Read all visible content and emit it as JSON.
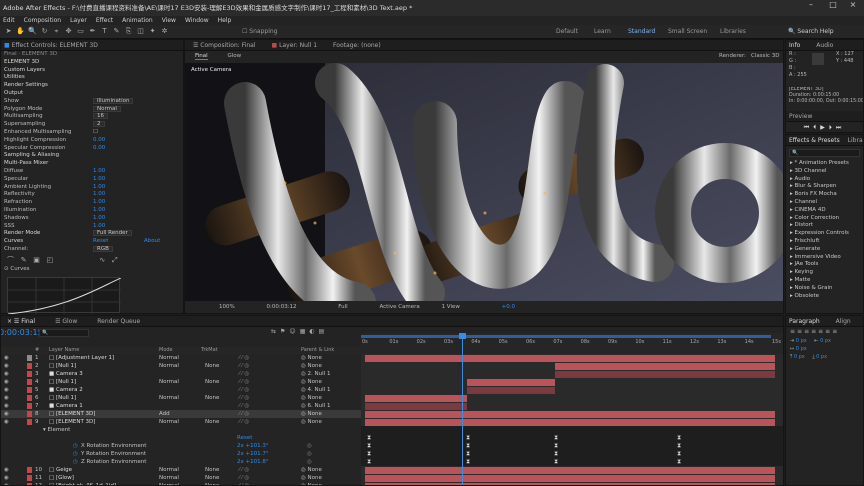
{
  "app": {
    "title": "Adobe After Effects - F:\\付费直播课程资料准备\\AE\\课时17 E3D安装-理解E3D效果和金属质感文字制作\\课时17_工程和素材\\3D Text.aep *"
  },
  "menu": [
    "Edit",
    "Composition",
    "Layer",
    "Effect",
    "Animation",
    "View",
    "Window",
    "Help"
  ],
  "toolbar": {
    "snapping": "Snapping",
    "workspaces": [
      "Default",
      "Learn",
      "Standard",
      "Small Screen",
      "Libraries"
    ],
    "active_workspace": "Standard",
    "search_help": "Search Help"
  },
  "effect_controls": {
    "tab": "Effect Controls: ELEMENT 3D",
    "crumb": "Final · ELEMENT 3D",
    "rows": [
      {
        "t": "ELEMENT 3D",
        "v": ""
      },
      {
        "t": "Custom Layers",
        "v": ""
      },
      {
        "t": "Utilities",
        "v": ""
      },
      {
        "t": "Render Settings",
        "v": ""
      },
      {
        "t": "Output",
        "v": ""
      },
      {
        "t": "  Show",
        "v": "Illumination",
        "dd": true
      },
      {
        "t": "  Polygon Mode",
        "v": "Normal",
        "dd": true
      },
      {
        "t": "  Multisampling",
        "v": "16",
        "dd": true
      },
      {
        "t": "  Supersampling",
        "v": "2",
        "dd": true
      },
      {
        "t": "  Enhanced Multisampling",
        "v": "☐"
      },
      {
        "t": "  Highlight Compression",
        "v": "0.00",
        "num": true
      },
      {
        "t": "  Specular Compression",
        "v": "0.00",
        "num": true
      },
      {
        "t": "Sampling & Aliasing",
        "v": ""
      },
      {
        "t": "Multi-Pass Mixer",
        "v": ""
      },
      {
        "t": "   Diffuse",
        "v": "1.00",
        "num": true
      },
      {
        "t": "   Specular",
        "v": "1.00",
        "num": true
      },
      {
        "t": "   Ambient Lighting",
        "v": "1.00",
        "num": true
      },
      {
        "t": "   Reflectivity",
        "v": "1.00",
        "num": true
      },
      {
        "t": "   Refraction",
        "v": "1.00",
        "num": true
      },
      {
        "t": "   Illumination",
        "v": "1.00",
        "num": true
      },
      {
        "t": "   Shadows",
        "v": "1.00",
        "num": true
      },
      {
        "t": "   SSS",
        "v": "1.00",
        "num": true
      },
      {
        "t": "Render Mode",
        "v": "Full Render",
        "dd": true
      }
    ],
    "curves": {
      "label": "Curves",
      "reset": "Reset",
      "about": "About"
    },
    "channel": {
      "label": "Channel:",
      "value": "RGB"
    },
    "curves_sub": "Curves"
  },
  "composition": {
    "tab_comp": "Composition: Final",
    "tab_layer": "Layer: Null 1",
    "tab_footage": "Footage: (none)",
    "sub_tabs": [
      "Final",
      "Glow"
    ],
    "renderer": "Renderer:",
    "renderer_value": "Classic 3D",
    "camera_label": "Active Camera",
    "footer": {
      "zoom": "100%",
      "time": "0:00:03:12",
      "res": "Full",
      "camera": "Active Camera",
      "view": "1 View",
      "offset": "+0.0"
    }
  },
  "info_panel": {
    "tabs": [
      "Info",
      "Audio"
    ],
    "lines": [
      "R :",
      "G :",
      "B :",
      "A : 255"
    ],
    "coords": [
      "X : 127",
      "Y : 448"
    ],
    "layer_lines": [
      "[ELEMENT 3D]",
      "Duration: 0:00:15:00",
      "In: 0:00:00:00, Out: 0:00:15:00"
    ],
    "preview": "Preview"
  },
  "effects_presets": {
    "tabs": [
      "Effects & Presets",
      "Libra"
    ],
    "search_placeholder": "",
    "items": [
      "Animation Presets",
      "3D Channel",
      "Audio",
      "Blur & Sharpen",
      "Boris FX Mocha",
      "Channel",
      "CINEMA 4D",
      "Color Correction",
      "Distort",
      "Expression Controls",
      "Frischluft",
      "Generate",
      "Immersive Video",
      "JAe Tools",
      "Keying",
      "Matte",
      "Noise & Grain",
      "Obsolete"
    ]
  },
  "paragraph": {
    "tabs": [
      "Paragraph",
      "Align"
    ],
    "fields": [
      "0 px",
      "0 px",
      "0 px",
      "0 px",
      "0 px"
    ]
  },
  "timeline": {
    "tabs": [
      "Final",
      "Glow",
      "Render Queue"
    ],
    "timecode": "0:00:03:15",
    "search_placeholder": "",
    "headers": {
      "num": "#",
      "name": "Layer Name",
      "mode": "Mode",
      "trkmat": "TrkMat",
      "switches": "",
      "parent": "Parent & Link"
    },
    "ruler": [
      "0s",
      "01s",
      "02s",
      "03s",
      "04s",
      "05s",
      "06s",
      "07s",
      "08s",
      "09s",
      "10s",
      "11s",
      "12s",
      "13s",
      "14s",
      "15s"
    ],
    "layers": [
      {
        "n": "1",
        "name": "[Adjustment Layer 1]",
        "mode": "Normal",
        "trk": "",
        "parent": "None",
        "color": "#8c8c8c"
      },
      {
        "n": "2",
        "name": "[Null 1]",
        "mode": "Normal",
        "trk": "None",
        "parent": "None",
        "color": "#c04848"
      },
      {
        "n": "3",
        "name": "Camera 3",
        "mode": "",
        "trk": "",
        "parent": "2. Null 1",
        "color": "#c04848"
      },
      {
        "n": "4",
        "name": "[Null 1]",
        "mode": "Normal",
        "trk": "None",
        "parent": "None",
        "color": "#c04848"
      },
      {
        "n": "5",
        "name": "Camera 2",
        "mode": "",
        "trk": "",
        "parent": "4. Null 1",
        "color": "#c04848"
      },
      {
        "n": "6",
        "name": "[Null 1]",
        "mode": "Normal",
        "trk": "None",
        "parent": "None",
        "color": "#c04848"
      },
      {
        "n": "7",
        "name": "Camera 1",
        "mode": "",
        "trk": "",
        "parent": "6. Null 1",
        "color": "#c04848"
      },
      {
        "n": "8",
        "name": "[ELEMENT 3D]",
        "mode": "Add",
        "trk": "",
        "parent": "None",
        "color": "#c04848"
      },
      {
        "n": "9",
        "name": "[ELEMENT 3D]",
        "mode": "Normal",
        "trk": "None",
        "parent": "None",
        "color": "#c04848"
      }
    ],
    "sub_rows": [
      {
        "label": "Element",
        "value": "",
        "kind": "group"
      },
      {
        "label": "Reset",
        "value": "",
        "kind": "reset"
      },
      {
        "label": "X Rotation Environment",
        "value": "2x +101.3°",
        "kind": "prop"
      },
      {
        "label": "Y Rotation Environment",
        "value": "2x +101.7°",
        "kind": "prop"
      },
      {
        "label": "Z Rotation Environment",
        "value": "2x +101.8°",
        "kind": "prop"
      }
    ],
    "layers_bottom": [
      {
        "n": "10",
        "name": "Geige",
        "mode": "Normal",
        "trk": "None",
        "parent": "None",
        "color": "#c04848"
      },
      {
        "n": "11",
        "name": "[Glow]",
        "mode": "Normal",
        "trk": "None",
        "parent": "None",
        "color": "#c04848"
      },
      {
        "n": "12",
        "name": "[Bright ok_4K_1d_1id]",
        "mode": "Normal",
        "trk": "None",
        "parent": "None",
        "color": "#c04848"
      }
    ]
  },
  "colors": {
    "accent": "#2d8ceb",
    "layer_bar": "#b8545a",
    "layer_bar_dim": "#7a3a40",
    "playhead": "#3b8be5"
  }
}
